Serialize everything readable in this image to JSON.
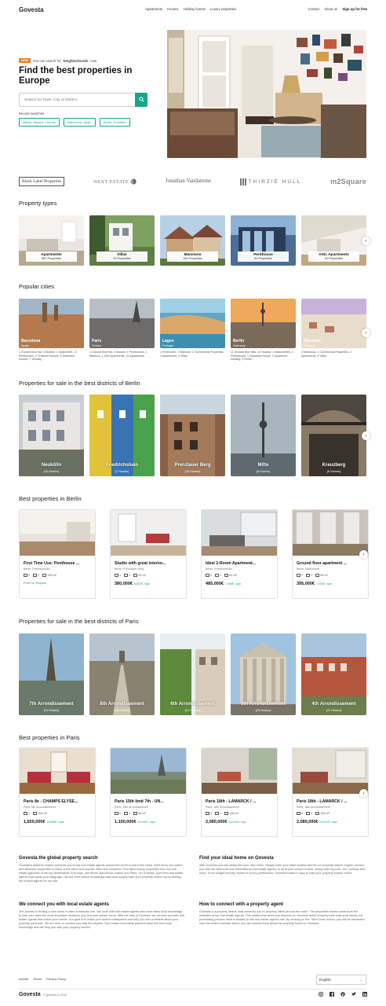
{
  "header": {
    "logo": "Govesta",
    "nav": [
      "Apartments",
      "Houses",
      "Holiday homes",
      "Luxury properties"
    ],
    "right": [
      "Contact",
      "About us",
      "Sign up for free"
    ]
  },
  "hero": {
    "badge": "NEW",
    "new_text": "You can search for",
    "new_bold": "Neighborhoods",
    "new_tail": "now",
    "title": "Find the best properties in Europe",
    "search_placeholder": "Search for Town, City or District",
    "recent_label": "Recent searches",
    "recent": [
      "Bilbao, Basque Country",
      "Barcelona, Spain",
      "Rome, Grosseto"
    ]
  },
  "brands": [
    "Black Label Properties",
    "NEXT ESTATE",
    "Jonathan Vandamme",
    "THIRZIE HULL",
    "m2Square"
  ],
  "property_types": {
    "title": "Property types",
    "items": [
      {
        "name": "Apartments",
        "count": "567 Properties"
      },
      {
        "name": "Villas",
        "count": "24 Properties"
      },
      {
        "name": "Mansions",
        "count": "150 Properties"
      },
      {
        "name": "Penthouse",
        "count": "61 Properties"
      },
      {
        "name": "Attic Apartments",
        "count": "40 Properties"
      }
    ]
  },
  "popular_cities": {
    "title": "Popular cities",
    "items": [
      {
        "name": "Barcelona",
        "country": "Spain",
        "desc": "1 Ground floor flat, 3 Studios, 1 Maisonette, 17 Penthouses, 2 Terraced houses, 6 Detached houses, 7 Holiday ..."
      },
      {
        "name": "Paris",
        "country": "France",
        "desc": "1 Ground floor flat, 3 Studios, 1 Penthouses, 1 Mansion, 1 Attic Apartments, 21 Apartments"
      },
      {
        "name": "Lagos",
        "country": "Portugal",
        "desc": "1 Penthouse, 1 Mansion, 1 Commercial Properties, 3 Apartments, 4 Villas"
      },
      {
        "name": "Berlin",
        "country": "Germany",
        "desc": "11 Ground floor flats, 16 Studios, 1 Maisonettes, 4 Penthouses, 1 Detached House, 1 Apartment building, 3 Resid..."
      },
      {
        "name": "Albufeira",
        "country": "Portugal",
        "desc": "2 Mansions, 1 Commercial Properties, 4 Apartments, 5 Villas"
      }
    ]
  },
  "berlin_districts": {
    "title": "Properties for sale in the best districts of Berlin",
    "items": [
      {
        "name": "Neukölln",
        "count": "(16 Homes)"
      },
      {
        "name": "Friedrichshain",
        "count": "(7 Homes)"
      },
      {
        "name": "Prenzlauer Berg",
        "count": "(10 Homes)"
      },
      {
        "name": "Mitte",
        "count": "(8 Homes)"
      },
      {
        "name": "Kreuzberg",
        "count": "(6 Homes)"
      }
    ]
  },
  "berlin_props": {
    "title": "Best properties in Berlin",
    "items": [
      {
        "title": "First Time Use: Penthouse ...",
        "loc": "Berlin, Friedrichshain",
        "rooms": "2",
        "baths": "2",
        "area": "148 m²",
        "price": "",
        "sqm": "",
        "link": "Price on Request"
      },
      {
        "title": "Studio with great interior...",
        "loc": "Berlin, Prenzlauer Berg",
        "rooms": "1",
        "baths": "1",
        "area": "43 m²",
        "price": "380,000€",
        "sqm": "8,837€ / sqm",
        "link": ""
      },
      {
        "title": "Ideal 2-Room Apartment...",
        "loc": "Berlin, Friedrichshain",
        "rooms": "2",
        "baths": "1",
        "area": "61 m²",
        "price": "485,000€",
        "sqm": "7,950€ / sqm",
        "link": ""
      },
      {
        "title": "Ground floor apartment ...",
        "loc": "Berlin, Weißensee",
        "rooms": "1",
        "baths": "1",
        "area": "56 m²",
        "price": "395,000€",
        "sqm": "7,053€ / sqm",
        "link": ""
      }
    ]
  },
  "paris_districts": {
    "title": "Properties for sale in the best districts of Paris",
    "items": [
      {
        "name": "7th Arrondissement",
        "count": "(10 Homes)"
      },
      {
        "name": "8th Arrondissement",
        "count": "(25 Homes)"
      },
      {
        "name": "6th Arrondissement",
        "count": "(17 Homes)"
      },
      {
        "name": "9th Arrondissement",
        "count": "(20 Homes)"
      },
      {
        "name": "4th Arrondissement",
        "count": "(12 Homes)"
      }
    ]
  },
  "paris_props": {
    "title": "Best properties in Paris",
    "items": [
      {
        "title": "Paris 8e - CHAMPS ÉLYSÉ...",
        "loc": "Paris, 8th Arrondissement",
        "rooms": "1",
        "baths": "1",
        "area": "104 m²",
        "price": "1,650,000€",
        "sqm": "15,865€ / sqm"
      },
      {
        "title": "Paris 15th limit 7th - UN...",
        "loc": "Paris, 15th Arrondissement",
        "rooms": "2",
        "baths": "1",
        "area": "69 m²",
        "price": "1,100,000€",
        "sqm": "15,942€ / sqm"
      },
      {
        "title": "Paris 18th - LAMARCK / ...",
        "loc": "Paris, 18th Arrondissement",
        "rooms": "1",
        "baths": "1",
        "area": "134 m²",
        "price": "2,080,000€",
        "sqm": "15,522€ / sqm"
      },
      {
        "title": "Paris 18th - LAMARCK / ...",
        "loc": "Paris, 18th Arrondissement",
        "rooms": "5",
        "baths": "1",
        "area": "135 m²",
        "price": "2,080,000€",
        "sqm": "15,407€ / sqm"
      }
    ]
  },
  "about": [
    {
      "title": "Govesta the global property search",
      "text": "Govesta's property search connects you to top real estate agents around the world in just a few clicks. We'll show you active and attractive properties in many of the listed and popular cities and countries. Find listed luxury properties from top real estate agencies of the top destinations in Europe, like Berlin, Barcelona, Lisbon and Paris. On Govesta, you'll find real estate agents that speak your language. Get the best market knowledge and local support with your property search by contacting the trusted agents on our site."
    },
    {
      "title": "Find your ideal home on Govesta",
      "text": "With Govesta you can easily find your new home. Simply enter your ideal location and let our property search engine connect you with the best local and international real estate agents. In all of your search results, simply filter by price, m2, rooftops and more. From budget friendly homes to luxury penthouses, Govesta makes it easy to start your property search online."
    },
    {
      "title": "We connect you with local estate agents",
      "text": "The journey to finding a new home is often a stressful one. We work with real estate agents who have deep local knowledge to help you make the most important decisions and find your dream home. With the help of Govesta, we connect you with real estate agents that match your needs. Our goal is to make your search transparent and help you feel confident about your property purchase. We are here to connect you with the experts. Our trusted real estate partners have the best local knowledge and will help you with your property search."
    },
    {
      "title": "How to connect with a property agent",
      "text": "Govesta is a property search that connects you to property offers around the world. The properties shown come from the websites of top real estate agents. This means that when you discover on Govesta which property best suits your needs, the purchasing process itself is started on the real estate agent's site. By clicking on the \"View Deal\" button, you will be forwarded onto the seller's website where you can contact them about the property found on Govesta."
    }
  ],
  "footer": {
    "links": [
      "Imprint",
      "Terms",
      "Privacy Policy"
    ],
    "language": "English",
    "logo": "Govesta",
    "copyright": "© govesta.co 2019"
  },
  "colors": {
    "accent": "#17a589",
    "badge": "#f47b20"
  }
}
